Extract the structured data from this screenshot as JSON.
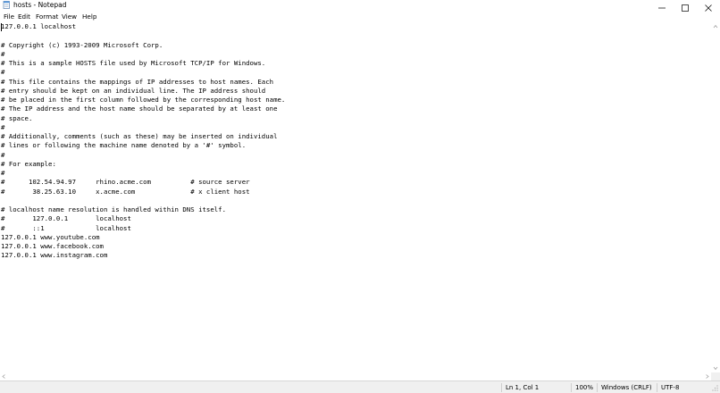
{
  "window": {
    "title": "hosts - Notepad",
    "app_icon": "notepad-icon",
    "controls": [
      "minimize-icon",
      "maximize-icon",
      "close-icon"
    ]
  },
  "menu": {
    "items": [
      "File",
      "Edit",
      "Format",
      "View",
      "Help"
    ]
  },
  "editor": {
    "lines": [
      "127.0.0.1 localhost",
      "",
      "# Copyright (c) 1993-2009 Microsoft Corp.",
      "#",
      "# This is a sample HOSTS file used by Microsoft TCP/IP for Windows.",
      "#",
      "# This file contains the mappings of IP addresses to host names. Each",
      "# entry should be kept on an individual line. The IP address should",
      "# be placed in the first column followed by the corresponding host name.",
      "# The IP address and the host name should be separated by at least one",
      "# space.",
      "#",
      "# Additionally, comments (such as these) may be inserted on individual",
      "# lines or following the machine name denoted by a '#' symbol.",
      "#",
      "# For example:",
      "#",
      "#      102.54.94.97     rhino.acme.com          # source server",
      "#       38.25.63.10     x.acme.com              # x client host",
      "",
      "# localhost name resolution is handled within DNS itself.",
      "#       127.0.0.1       localhost",
      "#       ::1             localhost",
      "127.0.0.1 www.youtube.com",
      "127.0.0.1 www.facebook.com",
      "127.0.0.1 www.instagram.com"
    ]
  },
  "statusbar": {
    "position": "Ln 1, Col 1",
    "zoom": "100%",
    "line_ending": "Windows (CRLF)",
    "encoding": "UTF-8"
  },
  "colors": {
    "background": "#ffffff",
    "statusbar_bg": "#f0f0f0",
    "text": "#000000"
  }
}
